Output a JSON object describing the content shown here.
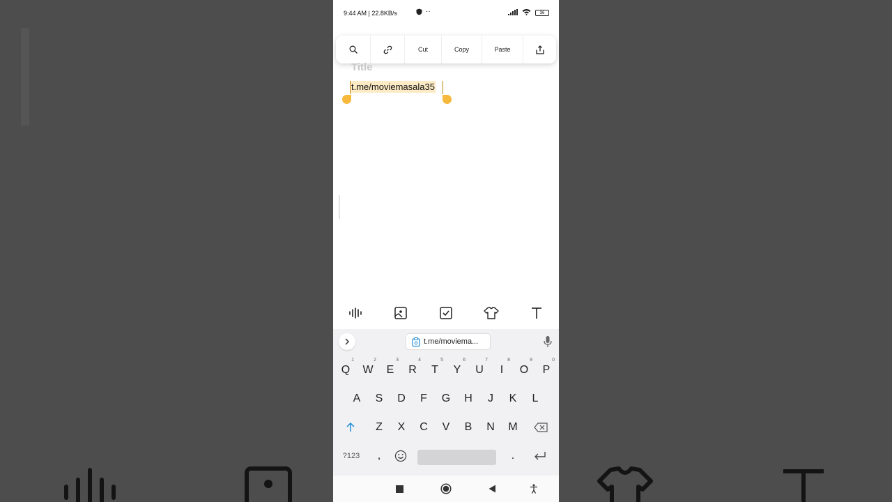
{
  "status_bar": {
    "time_speed": "9:44 AM | 22.8KB/s",
    "battery": "36"
  },
  "context_menu": {
    "items": [
      {
        "name": "search-icon"
      },
      {
        "name": "link-icon"
      },
      {
        "label": "Cut"
      },
      {
        "label": "Copy"
      },
      {
        "label": "Paste"
      },
      {
        "name": "share-icon"
      }
    ]
  },
  "note": {
    "title_placeholder": "Title",
    "body_text": "t.me/moviemasala35"
  },
  "editor_toolbar": {
    "icons": [
      "audio-wave-icon",
      "image-icon",
      "checkbox-icon",
      "shirt-theme-icon",
      "text-format-icon"
    ]
  },
  "keyboard": {
    "clipboard_suggestion": "t.me/moviema...",
    "row1": [
      {
        "k": "Q",
        "n": "1"
      },
      {
        "k": "W",
        "n": "2"
      },
      {
        "k": "E",
        "n": "3"
      },
      {
        "k": "R",
        "n": "4"
      },
      {
        "k": "T",
        "n": "5"
      },
      {
        "k": "Y",
        "n": "6"
      },
      {
        "k": "U",
        "n": "7"
      },
      {
        "k": "I",
        "n": "8"
      },
      {
        "k": "O",
        "n": "9"
      },
      {
        "k": "P",
        "n": "0"
      }
    ],
    "row2": [
      "A",
      "S",
      "D",
      "F",
      "G",
      "H",
      "J",
      "K",
      "L"
    ],
    "row3": [
      "Z",
      "X",
      "C",
      "V",
      "B",
      "N",
      "M"
    ],
    "symbols_key": "?123",
    "comma_key": ",",
    "period_key": ".",
    "accent_color": "#1a8cd8",
    "selection_color": "#f6b93b"
  }
}
